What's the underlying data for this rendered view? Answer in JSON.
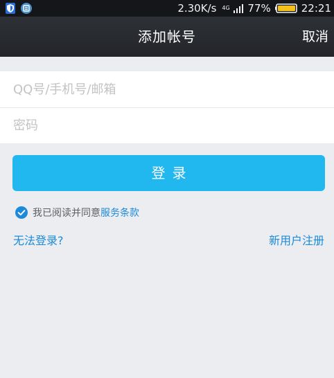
{
  "status_bar": {
    "speed": "2.30K/s",
    "network": "4G",
    "battery_percent": "77%",
    "time": "22:21",
    "icons": [
      "shield-icon",
      "notification-icon",
      "signal-icon",
      "battery-icon"
    ]
  },
  "header": {
    "title": "添加帐号",
    "cancel_label": "取消"
  },
  "form": {
    "account_placeholder": "QQ号/手机号/邮箱",
    "password_placeholder": "密码"
  },
  "login_button_label": "登录",
  "agreement": {
    "checked": true,
    "text": "我已阅读并同意",
    "terms_link": "服务条款"
  },
  "links": {
    "cannot_login": "无法登录?",
    "register": "新用户注册"
  },
  "colors": {
    "accent": "#21b7ef",
    "link": "#1c8ad8",
    "background": "#ebedf1",
    "titlebar": "#26282d"
  }
}
